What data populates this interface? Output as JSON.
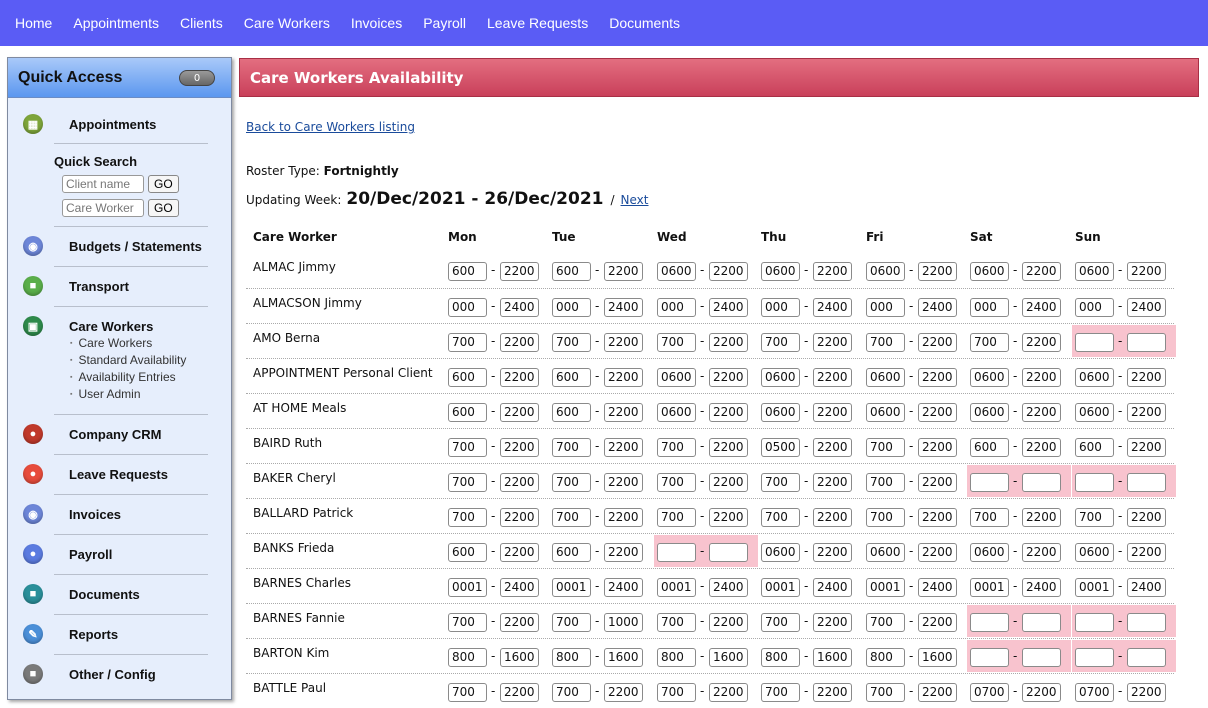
{
  "topnav": [
    "Home",
    "Appointments",
    "Clients",
    "Care Workers",
    "Invoices",
    "Payroll",
    "Leave Requests",
    "Documents"
  ],
  "sidebar": {
    "title": "Quick Access",
    "badge": "0",
    "items": [
      {
        "label": "Appointments",
        "icon": "calendar-icon",
        "color": "#7ea53a"
      },
      {
        "label": "Budgets / Statements",
        "icon": "budget-icon",
        "color": "#6d86d8"
      },
      {
        "label": "Transport",
        "icon": "bus-icon",
        "color": "#5aae4a"
      },
      {
        "label": "Care Workers",
        "icon": "care-workers-icon",
        "color": "#2e8a4b"
      },
      {
        "label": "Company CRM",
        "icon": "crm-icon",
        "color": "#c0392b"
      },
      {
        "label": "Leave Requests",
        "icon": "leave-icon",
        "color": "#e74c3c"
      },
      {
        "label": "Invoices",
        "icon": "invoice-icon",
        "color": "#6d86d8"
      },
      {
        "label": "Payroll",
        "icon": "payroll-icon",
        "color": "#5b7be0"
      },
      {
        "label": "Documents",
        "icon": "document-icon",
        "color": "#2a8f9a"
      },
      {
        "label": "Reports",
        "icon": "wrench-icon",
        "color": "#4b8fd8"
      },
      {
        "label": "Other / Config",
        "icon": "config-icon",
        "color": "#7a7a7a"
      }
    ],
    "care_workers_sub": [
      "Care Workers",
      "Standard Availability",
      "Availability Entries",
      "User Admin"
    ],
    "quick_search": {
      "title": "Quick Search",
      "client_placeholder": "Client name",
      "worker_placeholder": "Care Worker",
      "go": "GO"
    }
  },
  "main": {
    "title": "Care Workers Availability",
    "back_link": "Back to Care Workers listing",
    "roster_label": "Roster Type:",
    "roster_value": "Fortnightly",
    "week_label": "Updating Week:",
    "week_range": "20/Dec/2021 - 26/Dec/2021",
    "week_sep": "/",
    "next": "Next"
  },
  "grid": {
    "headers": [
      "Care Worker",
      "Mon",
      "Tue",
      "Wed",
      "Thu",
      "Fri",
      "Sat",
      "Sun"
    ],
    "rows": [
      {
        "name": "ALMAC Jimmy",
        "days": [
          [
            "600",
            "2200"
          ],
          [
            "600",
            "2200"
          ],
          [
            "0600",
            "2200"
          ],
          [
            "0600",
            "2200"
          ],
          [
            "0600",
            "2200"
          ],
          [
            "0600",
            "2200"
          ],
          [
            "0600",
            "2200"
          ]
        ]
      },
      {
        "name": "ALMACSON Jimmy",
        "days": [
          [
            "000",
            "2400"
          ],
          [
            "000",
            "2400"
          ],
          [
            "000",
            "2400"
          ],
          [
            "000",
            "2400"
          ],
          [
            "000",
            "2400"
          ],
          [
            "000",
            "2400"
          ],
          [
            "000",
            "2400"
          ]
        ]
      },
      {
        "name": "AMO Berna",
        "days": [
          [
            "700",
            "2200"
          ],
          [
            "700",
            "2200"
          ],
          [
            "700",
            "2200"
          ],
          [
            "700",
            "2200"
          ],
          [
            "700",
            "2200"
          ],
          [
            "700",
            "2200"
          ],
          [
            "",
            ""
          ]
        ]
      },
      {
        "name": "APPOINTMENT Personal Client",
        "days": [
          [
            "600",
            "2200"
          ],
          [
            "600",
            "2200"
          ],
          [
            "0600",
            "2200"
          ],
          [
            "0600",
            "2200"
          ],
          [
            "0600",
            "2200"
          ],
          [
            "0600",
            "2200"
          ],
          [
            "0600",
            "2200"
          ]
        ]
      },
      {
        "name": "AT HOME Meals",
        "days": [
          [
            "600",
            "2200"
          ],
          [
            "600",
            "2200"
          ],
          [
            "0600",
            "2200"
          ],
          [
            "0600",
            "2200"
          ],
          [
            "0600",
            "2200"
          ],
          [
            "0600",
            "2200"
          ],
          [
            "0600",
            "2200"
          ]
        ]
      },
      {
        "name": "BAIRD Ruth",
        "days": [
          [
            "700",
            "2200"
          ],
          [
            "700",
            "2200"
          ],
          [
            "700",
            "2200"
          ],
          [
            "0500",
            "2200"
          ],
          [
            "700",
            "2200"
          ],
          [
            "600",
            "2200"
          ],
          [
            "600",
            "2200"
          ]
        ]
      },
      {
        "name": "BAKER Cheryl",
        "days": [
          [
            "700",
            "2200"
          ],
          [
            "700",
            "2200"
          ],
          [
            "700",
            "2200"
          ],
          [
            "700",
            "2200"
          ],
          [
            "700",
            "2200"
          ],
          [
            "",
            ""
          ],
          [
            "",
            ""
          ]
        ]
      },
      {
        "name": "BALLARD Patrick",
        "days": [
          [
            "700",
            "2200"
          ],
          [
            "700",
            "2200"
          ],
          [
            "700",
            "2200"
          ],
          [
            "700",
            "2200"
          ],
          [
            "700",
            "2200"
          ],
          [
            "700",
            "2200"
          ],
          [
            "700",
            "2200"
          ]
        ]
      },
      {
        "name": "BANKS Frieda",
        "days": [
          [
            "600",
            "2200"
          ],
          [
            "600",
            "2200"
          ],
          [
            "",
            ""
          ],
          [
            "0600",
            "2200"
          ],
          [
            "0600",
            "2200"
          ],
          [
            "0600",
            "2200"
          ],
          [
            "0600",
            "2200"
          ]
        ]
      },
      {
        "name": "BARNES Charles",
        "days": [
          [
            "0001",
            "2400"
          ],
          [
            "0001",
            "2400"
          ],
          [
            "0001",
            "2400"
          ],
          [
            "0001",
            "2400"
          ],
          [
            "0001",
            "2400"
          ],
          [
            "0001",
            "2400"
          ],
          [
            "0001",
            "2400"
          ]
        ]
      },
      {
        "name": "BARNES Fannie",
        "days": [
          [
            "700",
            "2200"
          ],
          [
            "700",
            "1000"
          ],
          [
            "700",
            "2200"
          ],
          [
            "700",
            "2200"
          ],
          [
            "700",
            "2200"
          ],
          [
            "",
            ""
          ],
          [
            "",
            ""
          ]
        ]
      },
      {
        "name": "BARTON Kim",
        "days": [
          [
            "800",
            "1600"
          ],
          [
            "800",
            "1600"
          ],
          [
            "800",
            "1600"
          ],
          [
            "800",
            "1600"
          ],
          [
            "800",
            "1600"
          ],
          [
            "",
            ""
          ],
          [
            "",
            ""
          ]
        ]
      },
      {
        "name": "BATTLE Paul",
        "days": [
          [
            "700",
            "2200"
          ],
          [
            "700",
            "2200"
          ],
          [
            "700",
            "2200"
          ],
          [
            "700",
            "2200"
          ],
          [
            "700",
            "2200"
          ],
          [
            "0700",
            "2200"
          ],
          [
            "0700",
            "2200"
          ]
        ]
      }
    ]
  }
}
